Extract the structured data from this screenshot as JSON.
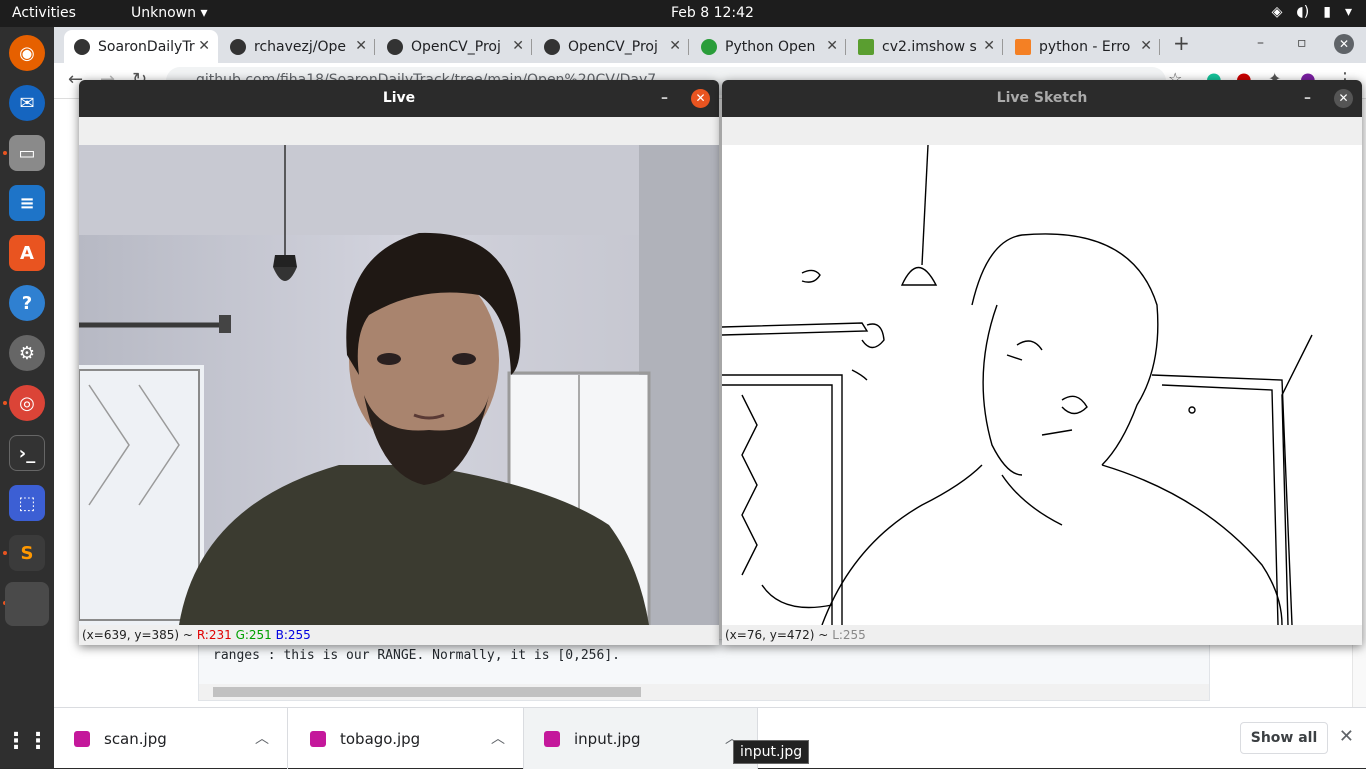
{
  "topbar": {
    "activities": "Activities",
    "app_menu": "Unknown",
    "clock": "Feb 8  12:42"
  },
  "dock": {
    "apps": [
      "firefox",
      "thunderbird",
      "files",
      "libreoffice-writer",
      "ubuntu-software",
      "help",
      "settings",
      "chrome",
      "terminal",
      "screenshot",
      "sublime-text",
      "opencv-window",
      "show-applications"
    ]
  },
  "browser": {
    "tabs": [
      {
        "title": "SoaronDailyTr",
        "icon": "github-icon"
      },
      {
        "title": "rchavezj/Ope",
        "icon": "github-icon"
      },
      {
        "title": "OpenCV_Proj",
        "icon": "github-icon"
      },
      {
        "title": "OpenCV_Proj",
        "icon": "github-icon"
      },
      {
        "title": "Python Open",
        "icon": "infinity-icon"
      },
      {
        "title": "cv2.imshow s",
        "icon": "bookmark-icon"
      },
      {
        "title": "python - Erro",
        "icon": "stackoverflow-icon"
      }
    ],
    "url": "github.com/fiha18/SoaronDailyTrack/tree/main/Open%20CV/Day7",
    "code_line": "ranges : this is our RANGE. Normally, it is [0,256]."
  },
  "downloads": {
    "items": [
      "scan.jpg",
      "tobago.jpg",
      "input.jpg"
    ],
    "show_all": "Show all",
    "tooltip": "input.jpg"
  },
  "live_window": {
    "title": "Live",
    "status_coords": "(x=639, y=385) ~",
    "r": "R:231",
    "g": "G:251",
    "b": "B:255"
  },
  "sketch_window": {
    "title": "Live Sketch",
    "status_coords": "(x=76, y=472) ~",
    "l": "L:255"
  },
  "colors": {
    "ubuntu_orange": "#e95420",
    "topbar": "#1d1d1d",
    "titlebar": "#2b2b2b"
  }
}
